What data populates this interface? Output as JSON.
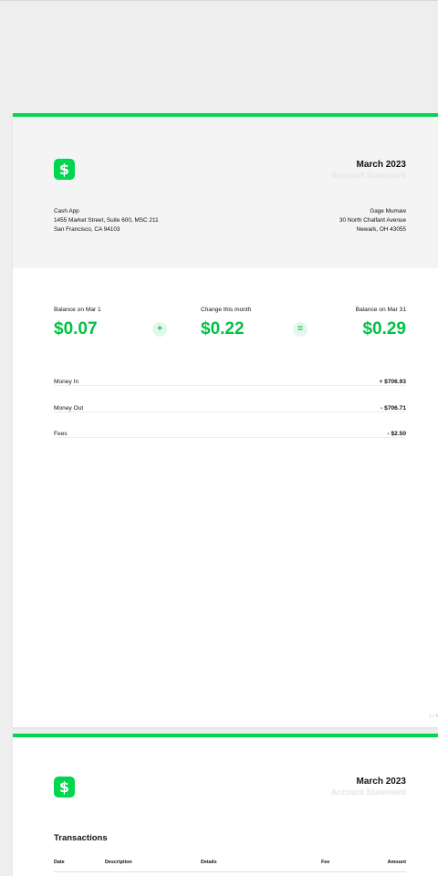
{
  "colors": {
    "brand_green": "#00d64f",
    "amount_green": "#00c244"
  },
  "page1": {
    "logo_icon": "dollar-sign-icon",
    "logo_glyph": "$",
    "month": "March 2023",
    "subtitle": "Account Statement",
    "sender": {
      "name": "Cash App",
      "street": "1455 Market Street, Suite 600, MSC 211",
      "city": "San Francisco, CA 94103"
    },
    "recipient": {
      "name": "Gage Mumaw",
      "street": "30 North Chalfant Avenue",
      "city": "Newark, OH 43055"
    },
    "balance": {
      "start_label": "Balance on Mar 1",
      "start_value": "$0.07",
      "plus_sign": "+",
      "change_label": "Change this month",
      "change_value": "$0.22",
      "equals_sign": "=",
      "end_label": "Balance on Mar 31",
      "end_value": "$0.29"
    },
    "summary": [
      {
        "label": "Money In",
        "amount": "+ $706.93"
      },
      {
        "label": "Money Out",
        "amount": "- $706.71"
      },
      {
        "label": "Fees",
        "amount": "- $2.50"
      }
    ],
    "page_number": "1 / 4"
  },
  "page2": {
    "logo_icon": "dollar-sign-icon",
    "logo_glyph": "$",
    "month": "March 2023",
    "subtitle": "Account Statement",
    "section_title": "Transactions",
    "columns": [
      "Date",
      "Description",
      "Details",
      "Fee",
      "Amount"
    ]
  }
}
